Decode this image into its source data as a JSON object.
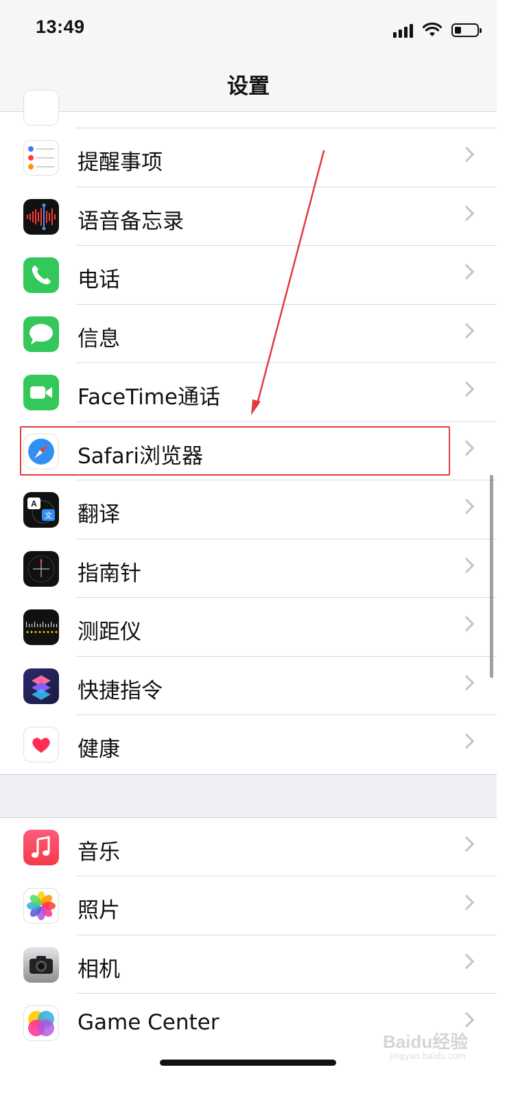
{
  "status_bar": {
    "time": "13:49",
    "battery_level": 0.3
  },
  "nav": {
    "title": "设置"
  },
  "group1": [
    {
      "key": "partial",
      "label": "",
      "icon": "partial-app-icon"
    },
    {
      "key": "reminders",
      "label": "提醒事项",
      "icon": "reminders-icon"
    },
    {
      "key": "voice-memos",
      "label": "语音备忘录",
      "icon": "voice-memos-icon"
    },
    {
      "key": "phone",
      "label": "电话",
      "icon": "phone-icon"
    },
    {
      "key": "messages",
      "label": "信息",
      "icon": "messages-icon"
    },
    {
      "key": "facetime",
      "label": "FaceTime通话",
      "icon": "facetime-icon"
    },
    {
      "key": "safari",
      "label": "Safari浏览器",
      "icon": "safari-icon"
    },
    {
      "key": "translate",
      "label": "翻译",
      "icon": "translate-icon"
    },
    {
      "key": "compass",
      "label": "指南针",
      "icon": "compass-icon"
    },
    {
      "key": "measure",
      "label": "测距仪",
      "icon": "measure-icon"
    },
    {
      "key": "shortcuts",
      "label": "快捷指令",
      "icon": "shortcuts-icon"
    },
    {
      "key": "health",
      "label": "健康",
      "icon": "health-icon"
    }
  ],
  "group2": [
    {
      "key": "music",
      "label": "音乐",
      "icon": "music-icon"
    },
    {
      "key": "photos",
      "label": "照片",
      "icon": "photos-icon"
    },
    {
      "key": "camera",
      "label": "相机",
      "icon": "camera-icon"
    },
    {
      "key": "game-center",
      "label": "Game Center",
      "icon": "game-center-icon"
    }
  ],
  "translate_icon_glyphs": {
    "a": "A",
    "b": "文"
  },
  "watermark": {
    "text": "Baidu经验",
    "sub": "jingyan.baidu.com"
  },
  "colors": {
    "highlight_border": "#e4393c",
    "annotation_arrow": "#e4393c",
    "group_gap_bg": "#efeff4",
    "nav_bg": "#f6f6f6"
  }
}
